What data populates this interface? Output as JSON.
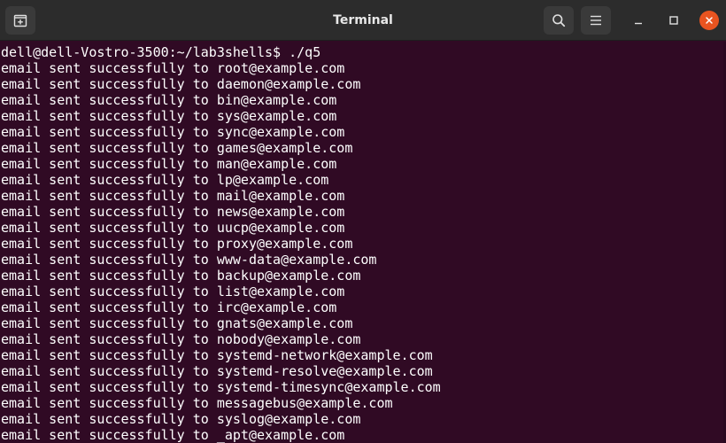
{
  "window": {
    "title": "Terminal"
  },
  "icons": {
    "new_tab": "new-tab-icon",
    "search": "search-icon",
    "menu": "hamburger-menu-icon",
    "minimize": "minimize-icon",
    "maximize": "maximize-icon",
    "close": "close-icon"
  },
  "colors": {
    "terminal_bg": "#300a24",
    "titlebar_bg": "#2c2c2c",
    "close_accent": "#e95420",
    "text": "#ffffff"
  },
  "terminal": {
    "lines": [
      "dell@dell-Vostro-3500:~/lab3shells$ ./q5",
      "email sent successfully to root@example.com",
      "email sent successfully to daemon@example.com",
      "email sent successfully to bin@example.com",
      "email sent successfully to sys@example.com",
      "email sent successfully to sync@example.com",
      "email sent successfully to games@example.com",
      "email sent successfully to man@example.com",
      "email sent successfully to lp@example.com",
      "email sent successfully to mail@example.com",
      "email sent successfully to news@example.com",
      "email sent successfully to uucp@example.com",
      "email sent successfully to proxy@example.com",
      "email sent successfully to www-data@example.com",
      "email sent successfully to backup@example.com",
      "email sent successfully to list@example.com",
      "email sent successfully to irc@example.com",
      "email sent successfully to gnats@example.com",
      "email sent successfully to nobody@example.com",
      "email sent successfully to systemd-network@example.com",
      "email sent successfully to systemd-resolve@example.com",
      "email sent successfully to systemd-timesync@example.com",
      "email sent successfully to messagebus@example.com",
      "email sent successfully to syslog@example.com",
      "email sent successfully to _apt@example.com"
    ]
  }
}
